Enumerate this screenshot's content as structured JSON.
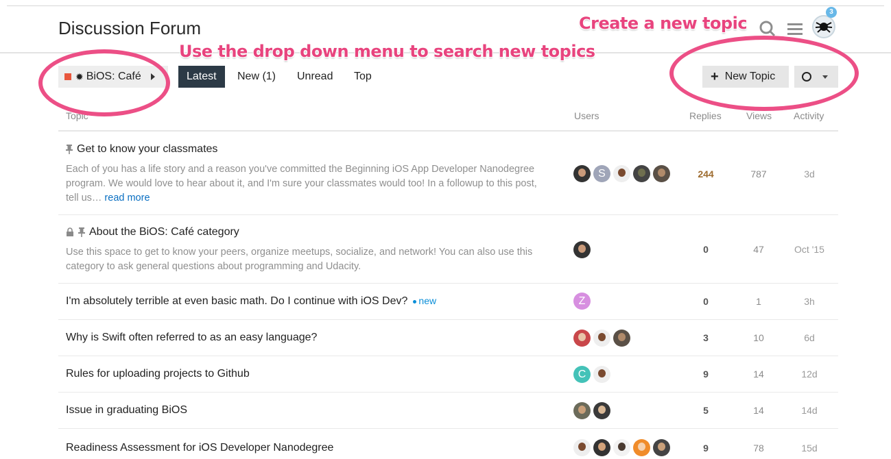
{
  "header": {
    "title": "Discussion Forum",
    "notification_count": "3"
  },
  "nav": {
    "category": "BiOS: Café",
    "tabs": [
      {
        "label": "Latest"
      },
      {
        "label": "New (1)"
      },
      {
        "label": "Unread"
      },
      {
        "label": "Top"
      }
    ],
    "new_topic_label": "New Topic"
  },
  "table": {
    "headers": {
      "topic": "Topic",
      "users": "Users",
      "replies": "Replies",
      "views": "Views",
      "activity": "Activity"
    },
    "rows": [
      {
        "title": "Get to know your classmates",
        "excerpt": "Each of you has a life story and a reason you've committed the Beginning iOS App Developer Nanodegree program. We would love to hear about it, and I'm sure your classmates would too! In a followup to this post, tell us…",
        "read_more": "read more",
        "replies": "244",
        "views": "787",
        "activity": "3d"
      },
      {
        "title": "About the BiOS: Café category",
        "excerpt": "Use this space to get to know your peers, organize meetups, socialize, and network! You can also use this category to ask general questions about programming and Udacity.",
        "replies": "0",
        "views": "47",
        "activity": "Oct '15"
      },
      {
        "title": "I'm absolutely terrible at even basic math. Do I continue with iOS Dev?",
        "new_label": "new",
        "avatar_letter": "Z",
        "replies": "0",
        "views": "1",
        "activity": "3h"
      },
      {
        "title": "Why is Swift often referred to as an easy language?",
        "replies": "3",
        "views": "10",
        "activity": "6d"
      },
      {
        "title": "Rules for uploading projects to Github",
        "avatar_letter": "C",
        "replies": "9",
        "views": "14",
        "activity": "12d"
      },
      {
        "title": "Issue in graduating BiOS",
        "replies": "5",
        "views": "14",
        "activity": "14d"
      },
      {
        "title": "Readiness Assessment for iOS Developer Nanodegree",
        "replies": "9",
        "views": "78",
        "activity": "15d"
      }
    ],
    "avatar_s_letter": "S"
  },
  "annotations": {
    "create_topic": "Create a new topic",
    "dropdown_hint": "Use the drop down menu to search new topics"
  },
  "colors": {
    "category": "#e8573d",
    "active_tab": "#2c3a46",
    "annotation": "#e8447e",
    "link": "#0a6fc2"
  }
}
